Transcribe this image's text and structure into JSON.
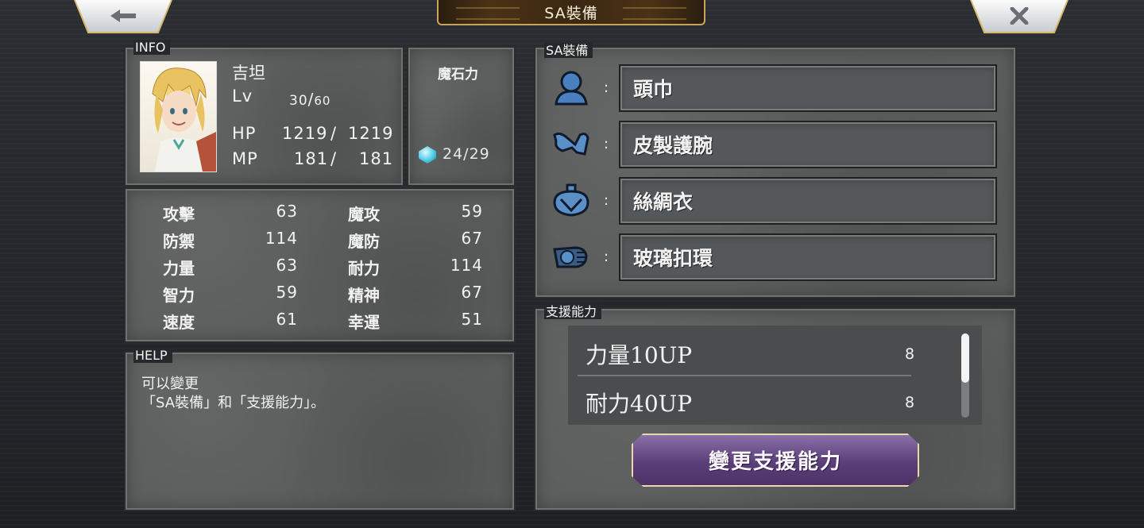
{
  "header": {
    "title": "SA裝備",
    "back_icon": "arrow-left-icon",
    "close_icon": "close-icon"
  },
  "info": {
    "section_label": "INFO",
    "name": "吉坦",
    "lv_label": "Lv",
    "lv_value": "30",
    "lv_max": "60",
    "hp_label": "HP",
    "hp_current": "1219",
    "hp_max": "1219",
    "mp_label": "MP",
    "mp_current": "181",
    "mp_max": "181",
    "stone_title": "魔石力",
    "stone_value": "24/29"
  },
  "stats": [
    {
      "label": "攻擊",
      "value": "63"
    },
    {
      "label": "魔攻",
      "value": "59"
    },
    {
      "label": "防禦",
      "value": "114"
    },
    {
      "label": "魔防",
      "value": "67"
    },
    {
      "label": "力量",
      "value": "63"
    },
    {
      "label": "耐力",
      "value": "114"
    },
    {
      "label": "智力",
      "value": "59"
    },
    {
      "label": "精神",
      "value": "67"
    },
    {
      "label": "速度",
      "value": "61"
    },
    {
      "label": "幸運",
      "value": "51"
    }
  ],
  "help": {
    "section_label": "HELP",
    "line1": "可以變更",
    "line2": "「SA裝備」和「支援能力」。"
  },
  "equipment": {
    "section_label": "SA裝備",
    "colon": ":",
    "slots": [
      {
        "icon": "head-icon",
        "name": "頭巾"
      },
      {
        "icon": "arm-guard-icon",
        "name": "皮製護腕"
      },
      {
        "icon": "armor-icon",
        "name": "絲綢衣"
      },
      {
        "icon": "accessory-icon",
        "name": "玻璃扣環"
      }
    ]
  },
  "support": {
    "section_label": "支援能力",
    "abilities": [
      {
        "name": "力量10UP",
        "cost": "8"
      },
      {
        "name": "耐力40UP",
        "cost": "8"
      }
    ],
    "change_button": "變更支援能力"
  }
}
